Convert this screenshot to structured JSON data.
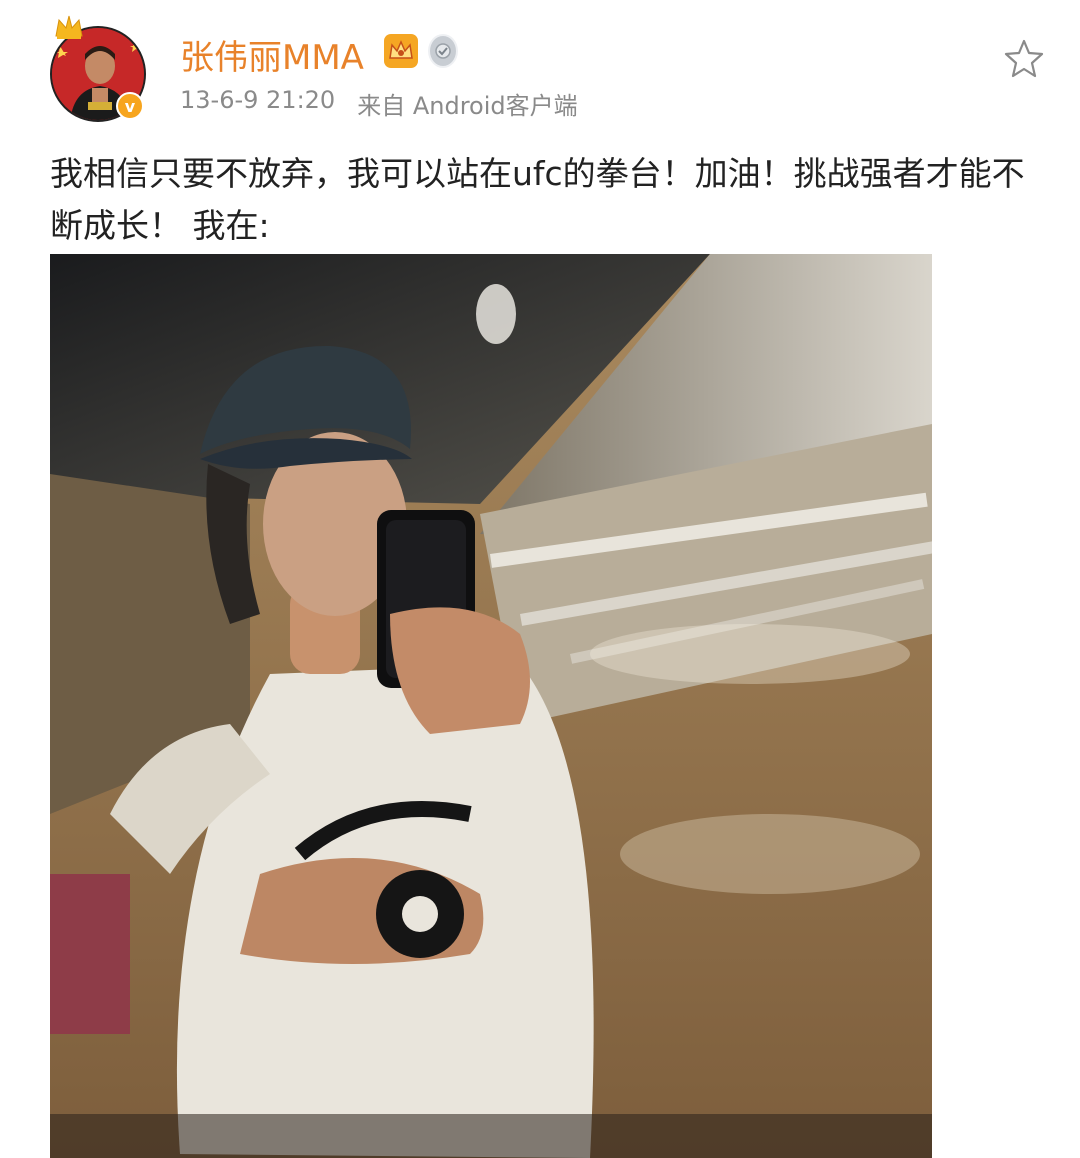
{
  "post": {
    "author": "张伟丽MMA",
    "timestamp": "13-6-9 21:20",
    "source": "来自 Android客户端",
    "text": "我相信只要不放弃，我可以站在ufc的拳台！加油！挑战强者才能不断成长！ 我在:"
  },
  "icons": {
    "avatar": "avatar-image",
    "crown": "crown-icon",
    "verified": "verified-badge-icon",
    "vip": "vip-badge-icon",
    "medal": "medal-badge-icon",
    "favorite": "star-outline-icon"
  },
  "colors": {
    "author_name": "#e8822a",
    "meta_text": "#8a8a8a",
    "verified_badge": "#f7a51e"
  }
}
